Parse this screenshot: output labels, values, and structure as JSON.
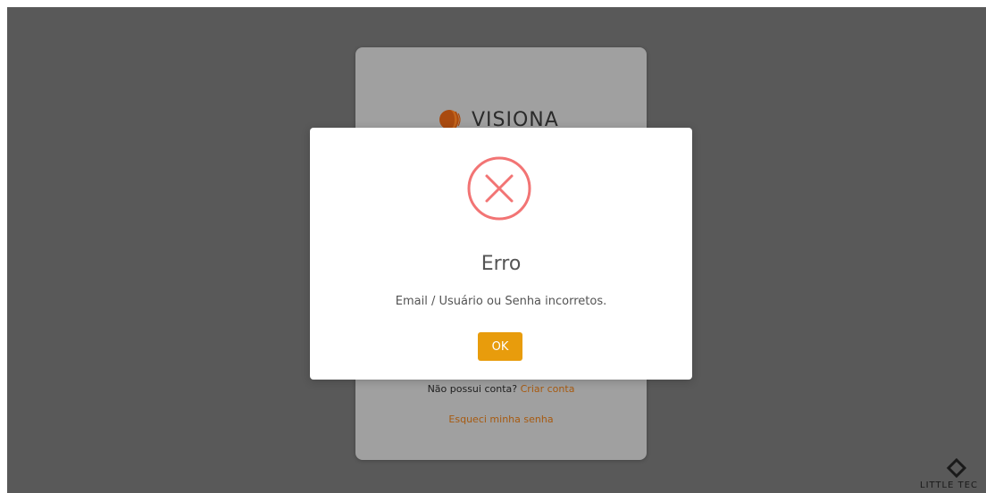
{
  "login": {
    "logo_text": "VISIONA",
    "signup_prompt": "Não possui conta?",
    "signup_link": "Criar conta",
    "forgot_link": "Esqueci minha senha"
  },
  "modal": {
    "icon": "error-x-circle-icon",
    "title": "Erro",
    "message": "Email / Usuário ou Senha incorretos.",
    "ok_label": "OK"
  },
  "corner_brand": {
    "icon": "diamond-icon",
    "text": "LITTLE TEC"
  },
  "colors": {
    "overlay": "#595959",
    "card": "#a0a0a0",
    "accent": "#e89c0c",
    "error": "#f27474",
    "link": "#a75a10"
  }
}
